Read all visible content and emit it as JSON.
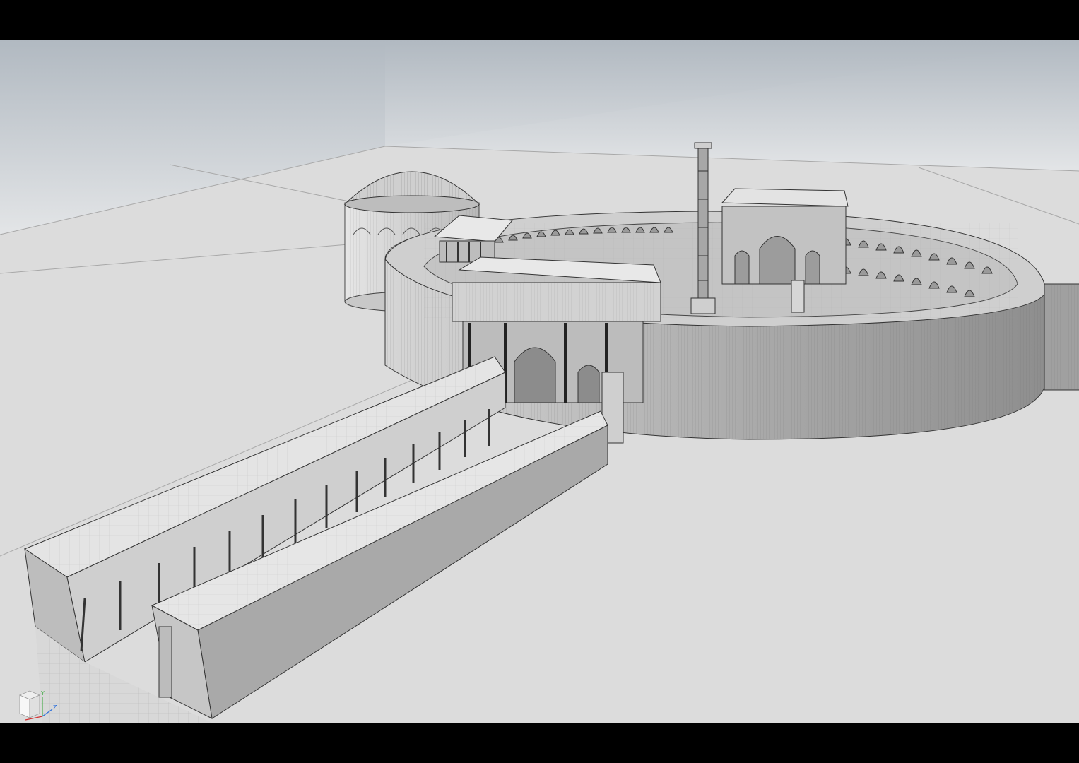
{
  "viewport": {
    "name": "perspective-3d-viewport",
    "scene": "wireframe-shaded-architecture-model",
    "colors": {
      "sky_top": "#b4bcc3",
      "sky_horizon": "#e2e4e6",
      "ground": "#dedede",
      "wall_light": "#d9d9d9",
      "wall_mid": "#bdbdbd",
      "wall_dark": "#9e9e9e",
      "outline": "#3a3a3a",
      "letterbox": "#000000"
    }
  },
  "axis_gizmo": {
    "y_label": "Y",
    "z_label": "Z",
    "y_color": "#4caf50",
    "z_color": "#2a6fdb",
    "x_color": "#d32f2f"
  }
}
